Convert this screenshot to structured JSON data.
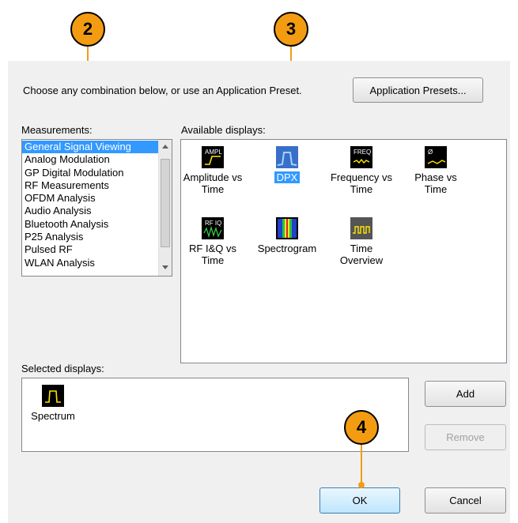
{
  "callouts": [
    "2",
    "3",
    "4"
  ],
  "intro_text": "Choose any combination below, or use an Application Preset.",
  "application_presets_label": "Application Presets...",
  "measurements_label": "Measurements:",
  "measurements": [
    "General Signal Viewing",
    "Analog Modulation",
    "GP Digital Modulation",
    "RF Measurements",
    "OFDM Analysis",
    "Audio Analysis",
    "Bluetooth Analysis",
    "P25 Analysis",
    "Pulsed RF",
    "WLAN Analysis"
  ],
  "selected_measurement": "General Signal Viewing",
  "available_label": "Available displays:",
  "available_displays": [
    {
      "label": "Amplitude vs Time",
      "icon": "ampl-icon",
      "icon_text": "AMPL"
    },
    {
      "label": "DPX",
      "icon": "dpx-icon",
      "icon_text": ""
    },
    {
      "label": "Frequency vs Time",
      "icon": "freq-icon",
      "icon_text": "FREQ"
    },
    {
      "label": "Phase vs Time",
      "icon": "phase-icon",
      "icon_text": "Ø"
    },
    {
      "label": "RF I&Q vs Time",
      "icon": "rfiq-icon",
      "icon_text": "RF IQ"
    },
    {
      "label": "Spectrogram",
      "icon": "spectrogram-icon",
      "icon_text": ""
    },
    {
      "label": "Time Overview",
      "icon": "time-overview-icon",
      "icon_text": ""
    }
  ],
  "selected_available": "DPX",
  "selected_label": "Selected displays:",
  "selected_displays": [
    {
      "label": "Spectrum",
      "icon": "spectrum-icon"
    }
  ],
  "add_label": "Add",
  "remove_label": "Remove",
  "ok_label": "OK",
  "cancel_label": "Cancel",
  "colors": {
    "callout": "#f39c12",
    "selection": "#3399ff",
    "dialog_bg": "#f0f0f0"
  }
}
